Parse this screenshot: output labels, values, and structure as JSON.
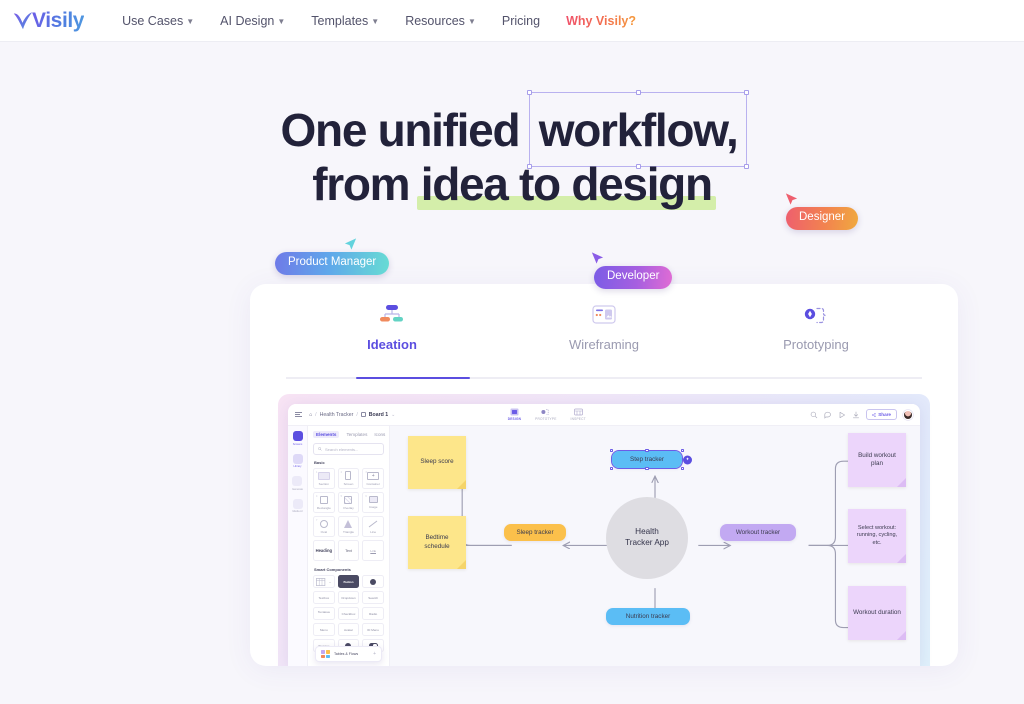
{
  "brand": {
    "name": "Visily"
  },
  "nav": {
    "items": [
      {
        "label": "Use Cases",
        "has_caret": true,
        "highlight": false
      },
      {
        "label": "AI Design",
        "has_caret": true,
        "highlight": false
      },
      {
        "label": "Templates",
        "has_caret": true,
        "highlight": false
      },
      {
        "label": "Resources",
        "has_caret": true,
        "highlight": false
      },
      {
        "label": "Pricing",
        "has_caret": false,
        "highlight": false
      },
      {
        "label": "Why Visily?",
        "has_caret": false,
        "highlight": true
      }
    ]
  },
  "hero": {
    "line1_before": "One unified ",
    "line1_selected": "workflow,",
    "line2_before": "from ",
    "line2_highlight": "idea to design",
    "cursors": [
      {
        "role": "Product Manager",
        "color": "#5fa8ea"
      },
      {
        "role": "Developer",
        "color": "#8a5ce6"
      },
      {
        "role": "Designer",
        "color": "#ee5f6e"
      }
    ]
  },
  "feature_tabs": [
    {
      "label": "Ideation",
      "icon": "hierarchy-icon",
      "active": true
    },
    {
      "label": "Wireframing",
      "icon": "wireframe-icon",
      "active": false
    },
    {
      "label": "Prototyping",
      "icon": "prototype-icon",
      "active": false
    }
  ],
  "mockup": {
    "breadcrumb": {
      "home": "⌂",
      "project": "Health Tracker",
      "board": "Board 1",
      "separator": "/"
    },
    "center_tools": [
      {
        "label": "DESIGN",
        "active": true
      },
      {
        "label": "PROTOTYPE",
        "active": false
      },
      {
        "label": "INSPECT",
        "active": false
      }
    ],
    "right_tools": [
      {
        "name": "search-icon"
      },
      {
        "name": "comment-icon"
      },
      {
        "name": "play-icon"
      },
      {
        "name": "download-icon"
      }
    ],
    "share_label": "Share",
    "rail": [
      {
        "label": "Screens",
        "state": "active"
      },
      {
        "label": "Library",
        "state": "sel"
      },
      {
        "label": "Generate",
        "state": "idle"
      },
      {
        "label": "Media AI",
        "state": "idle"
      }
    ],
    "panel": {
      "tabs": [
        {
          "label": "Elements",
          "active": true
        },
        {
          "label": "Templates",
          "active": false
        },
        {
          "label": "Icons",
          "active": false
        }
      ],
      "search_placeholder": "Search elements...",
      "basic_title": "Basic",
      "basic_tiles": [
        {
          "label": "Section",
          "num": "1"
        },
        {
          "label": "Screen",
          "num": "2"
        },
        {
          "label": "Container",
          "num": "3"
        },
        {
          "label": "Rectangle",
          "num": "4"
        },
        {
          "label": "Overlay",
          "num": "5"
        },
        {
          "label": "Image",
          "num": "6"
        },
        {
          "label": "Oval",
          "num": "7"
        },
        {
          "label": "Triangle",
          "num": "8"
        },
        {
          "label": "Line",
          "num": "9"
        },
        {
          "label": "Heading",
          "num": "0",
          "big": true
        },
        {
          "label": "Text",
          "big": true
        },
        {
          "label": "Link",
          "big": true
        }
      ],
      "smart_title": "Smart Components",
      "smart_tiles": [
        {
          "label": "Table",
          "kind": "table"
        },
        {
          "label": "Button",
          "kind": "dark"
        },
        {
          "label": "",
          "kind": "dot"
        },
        {
          "label": "Textbox",
          "kind": "plain"
        },
        {
          "label": "Dropdown",
          "kind": "plain"
        },
        {
          "label": "Search",
          "kind": "plain"
        },
        {
          "label": "Textarea",
          "kind": "area"
        },
        {
          "label": "Checkbox",
          "kind": "plain"
        },
        {
          "label": "Radio",
          "kind": "plain"
        },
        {
          "label": "Menu",
          "kind": "plain"
        },
        {
          "label": "Avatar",
          "kind": "plain"
        },
        {
          "label": "ID Menu",
          "kind": "plain"
        },
        {
          "label": "Stepper",
          "kind": "plain"
        },
        {
          "label": "",
          "kind": "dot"
        },
        {
          "label": "",
          "kind": "toggle"
        }
      ],
      "float_chip": "Tables & Flows"
    },
    "diagram": {
      "hub": {
        "line1": "Health",
        "line2": "Tracker App"
      },
      "nodes": [
        {
          "id": "sleep-score",
          "text": "Sleep score",
          "type": "sticky-yellow"
        },
        {
          "id": "bedtime-schedule",
          "text": "Bedtime schedule",
          "type": "sticky-yellow"
        },
        {
          "id": "sleep-tracker",
          "text": "Sleep tracker",
          "type": "pill-orange"
        },
        {
          "id": "step-tracker",
          "text": "Step tracker",
          "type": "pill-blue",
          "selected": true
        },
        {
          "id": "nutrition-tracker",
          "text": "Nutrition tracker",
          "type": "pill-blue"
        },
        {
          "id": "workout-tracker",
          "text": "Workout tracker",
          "type": "pill-purple"
        },
        {
          "id": "build-workout-plan",
          "text": "Build workout plan",
          "type": "sticky-purple"
        },
        {
          "id": "select-workout",
          "text": "Select workout: running, cycling, etc.",
          "type": "sticky-purple"
        },
        {
          "id": "workout-duration",
          "text": "Workout duration",
          "type": "sticky-purple"
        }
      ]
    }
  }
}
